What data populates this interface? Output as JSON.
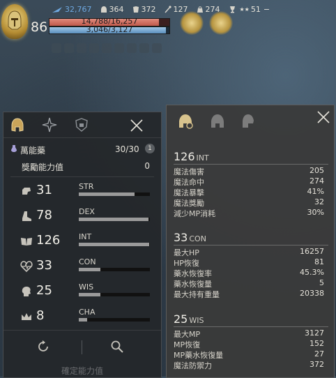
{
  "hud": {
    "level": "86",
    "combat_power": "32,767",
    "stat_a": "364",
    "stat_b": "372",
    "stat_c": "127",
    "stat_d": "274",
    "stat_e": "51",
    "stat_e_prefix": "★★",
    "stat_e_suffix": "−",
    "hp_text": "14,788/16,257",
    "hp_fraction": 0.91,
    "mp_text": "3,046/3,127",
    "mp_fraction": 0.97,
    "colors": {
      "hp": "#c05a4c",
      "mp": "#5a8fbd",
      "cp": "#6ea8e0",
      "gold": "#b5933f"
    }
  },
  "left_panel": {
    "tabs": [
      "helmet-tab-icon",
      "star-tab-icon",
      "shield-tab-icon"
    ],
    "elixir": {
      "label": "萬能藥",
      "count": "30/30",
      "badge": "1"
    },
    "bonus": {
      "label": "獎勵能力值",
      "value": "0"
    },
    "stats": [
      {
        "icon": "fist-icon",
        "value": "31",
        "name": "STR",
        "fill": 0.78
      },
      {
        "icon": "boot-icon",
        "value": "78",
        "name": "DEX",
        "fill": 0.98
      },
      {
        "icon": "book-icon",
        "value": "126",
        "name": "INT",
        "fill": 0.99
      },
      {
        "icon": "heart-icon",
        "value": "33",
        "name": "CON",
        "fill": 0.3
      },
      {
        "icon": "head-icon",
        "value": "25",
        "name": "WIS",
        "fill": 0.3
      },
      {
        "icon": "crown-icon",
        "value": "8",
        "name": "CHA",
        "fill": 0.12
      }
    ],
    "confirm_label": "確定能力值"
  },
  "right_panel": {
    "tabs": [
      "helmet-gear-icon",
      "helmet-icon",
      "helmet-side-icon"
    ],
    "sections": [
      {
        "value": "126",
        "name": "INT",
        "rows": [
          {
            "label": "魔法傷害",
            "value": "205"
          },
          {
            "label": "魔法命中",
            "value": "274"
          },
          {
            "label": "魔法暴擊",
            "value": "41%"
          },
          {
            "label": "魔法獎勵",
            "value": "32"
          },
          {
            "label": "減少MP消耗",
            "value": "30%"
          }
        ]
      },
      {
        "value": "33",
        "name": "CON",
        "rows": [
          {
            "label": "最大HP",
            "value": "16257"
          },
          {
            "label": "HP恢復",
            "value": "81"
          },
          {
            "label": "藥水恢復率",
            "value": "45.3%"
          },
          {
            "label": "藥水恢復量",
            "value": "5"
          },
          {
            "label": "最大持有重量",
            "value": "20338"
          }
        ]
      },
      {
        "value": "25",
        "name": "WIS",
        "rows": [
          {
            "label": "最大MP",
            "value": "3127"
          },
          {
            "label": "MP恢復",
            "value": "152"
          },
          {
            "label": "MP藥水恢復量",
            "value": "27"
          },
          {
            "label": "魔法防禦力",
            "value": "372"
          }
        ]
      }
    ]
  }
}
